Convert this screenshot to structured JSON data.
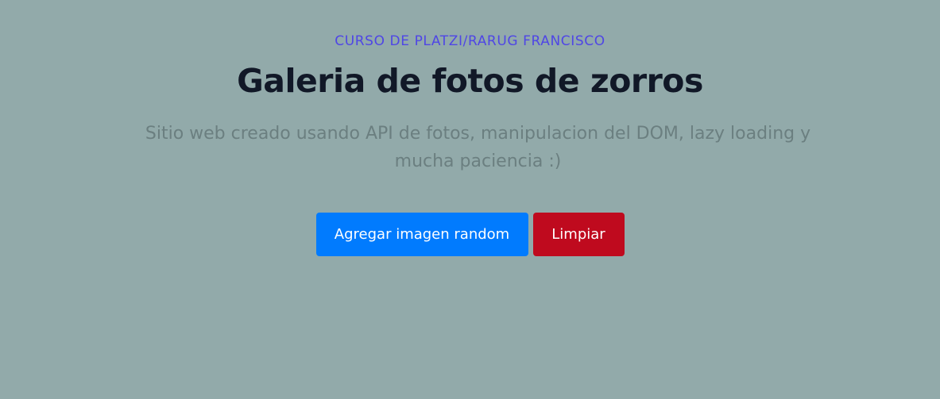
{
  "header": {
    "eyebrow": "CURSO DE PLATZI/RARUG FRANCISCO",
    "title": "Galeria de fotos de zorros",
    "subtitle": "Sitio web creado usando API de fotos, manipulacion del DOM, lazy loading y mucha paciencia :)"
  },
  "actions": {
    "add_label": "Agregar imagen random",
    "clear_label": "Limpiar"
  },
  "colors": {
    "background": "#92aaaa",
    "accent": "#4f46e5",
    "title": "#111827",
    "subtitle": "#6b7f80",
    "primary_button": "#017bfe",
    "danger_button": "#bf0a1e"
  }
}
